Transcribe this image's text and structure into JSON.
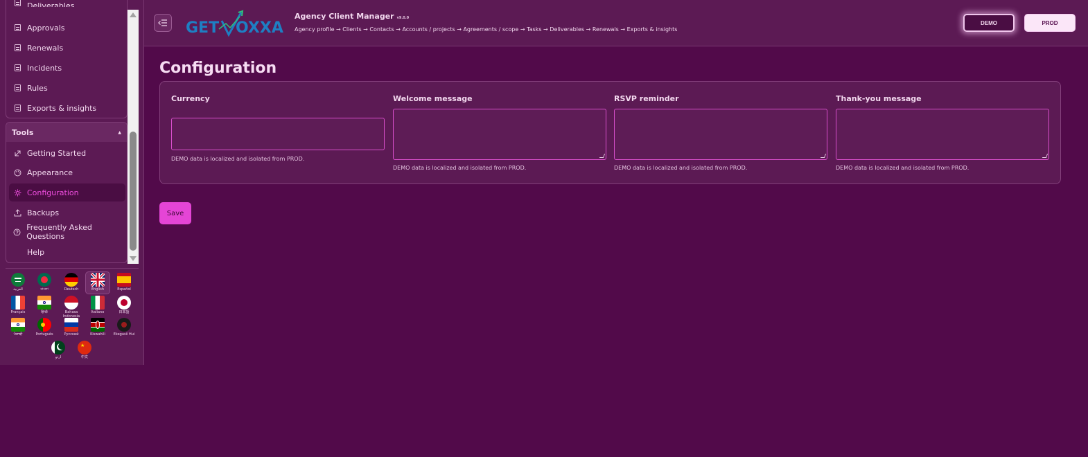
{
  "sidebar": {
    "partial_item": "Deliverables",
    "items": [
      {
        "label": "Approvals",
        "icon": "document-icon"
      },
      {
        "label": "Renewals",
        "icon": "document-icon"
      },
      {
        "label": "Incidents",
        "icon": "document-icon"
      },
      {
        "label": "Rules",
        "icon": "document-icon"
      },
      {
        "label": "Exports & insights",
        "icon": "document-icon"
      }
    ],
    "tools_header": "Tools",
    "tools_items": [
      {
        "label": "Getting Started",
        "icon": "rocket-icon",
        "active": false
      },
      {
        "label": "Appearance",
        "icon": "palette-icon",
        "active": false
      },
      {
        "label": "Configuration",
        "icon": "gear-icon",
        "active": true
      },
      {
        "label": "Backups",
        "icon": "upload-icon",
        "active": false
      },
      {
        "label": "Frequently Asked Questions",
        "icon": "question-icon",
        "active": false
      },
      {
        "label": "Help",
        "icon": "",
        "active": false
      }
    ],
    "languages": [
      {
        "label": "العربية",
        "flag": "sa"
      },
      {
        "label": "বাংলা",
        "flag": "bd"
      },
      {
        "label": "Deutsch",
        "flag": "de"
      },
      {
        "label": "English",
        "flag": "gb",
        "selected": true
      },
      {
        "label": "Español",
        "flag": "es"
      },
      {
        "label": "Français",
        "flag": "fr"
      },
      {
        "label": "हिन्दी",
        "flag": "in"
      },
      {
        "label": "Bahasa Indonesia",
        "flag": "id"
      },
      {
        "label": "Italiano",
        "flag": "it"
      },
      {
        "label": "日本語",
        "flag": "jp"
      },
      {
        "label": "ਪੰਜਾਬੀ",
        "flag": "in2"
      },
      {
        "label": "Português",
        "flag": "pt"
      },
      {
        "label": "Русский",
        "flag": "ru"
      },
      {
        "label": "Kiswahili",
        "flag": "ke"
      },
      {
        "label": "Ekegusii Hui",
        "flag": "hk"
      },
      {
        "label": "اردو",
        "flag": "pk"
      },
      {
        "label": "中文",
        "flag": "cn"
      }
    ]
  },
  "header": {
    "logo_text_left": "GET",
    "logo_text_right": "OXXA",
    "app_title": "Agency Client Manager",
    "version": "v9.0.0",
    "breadcrumb": "Agency profile → Clients → Contacts → Accounts / projects → Agreements / scope → Tasks → Deliverables → Renewals → Exports & insights",
    "env_demo": "DEMO",
    "env_prod": "PROD"
  },
  "main": {
    "page_title": "Configuration",
    "fields": [
      {
        "label": "Currency",
        "value": "",
        "help": "DEMO data is localized and isolated from PROD."
      },
      {
        "label": "Welcome message",
        "value": "",
        "help": "DEMO data is localized and isolated from PROD."
      },
      {
        "label": "RSVP reminder",
        "value": "",
        "help": "DEMO data is localized and isolated from PROD."
      },
      {
        "label": "Thank-you message",
        "value": "",
        "help": "DEMO data is localized and isolated from PROD."
      }
    ],
    "save_label": "Save"
  },
  "colors": {
    "background": "#520a4a",
    "panel": "#5c1a54",
    "accent": "#e545d6",
    "active_text": "#f04ee0",
    "text": "#f3d9ef"
  }
}
